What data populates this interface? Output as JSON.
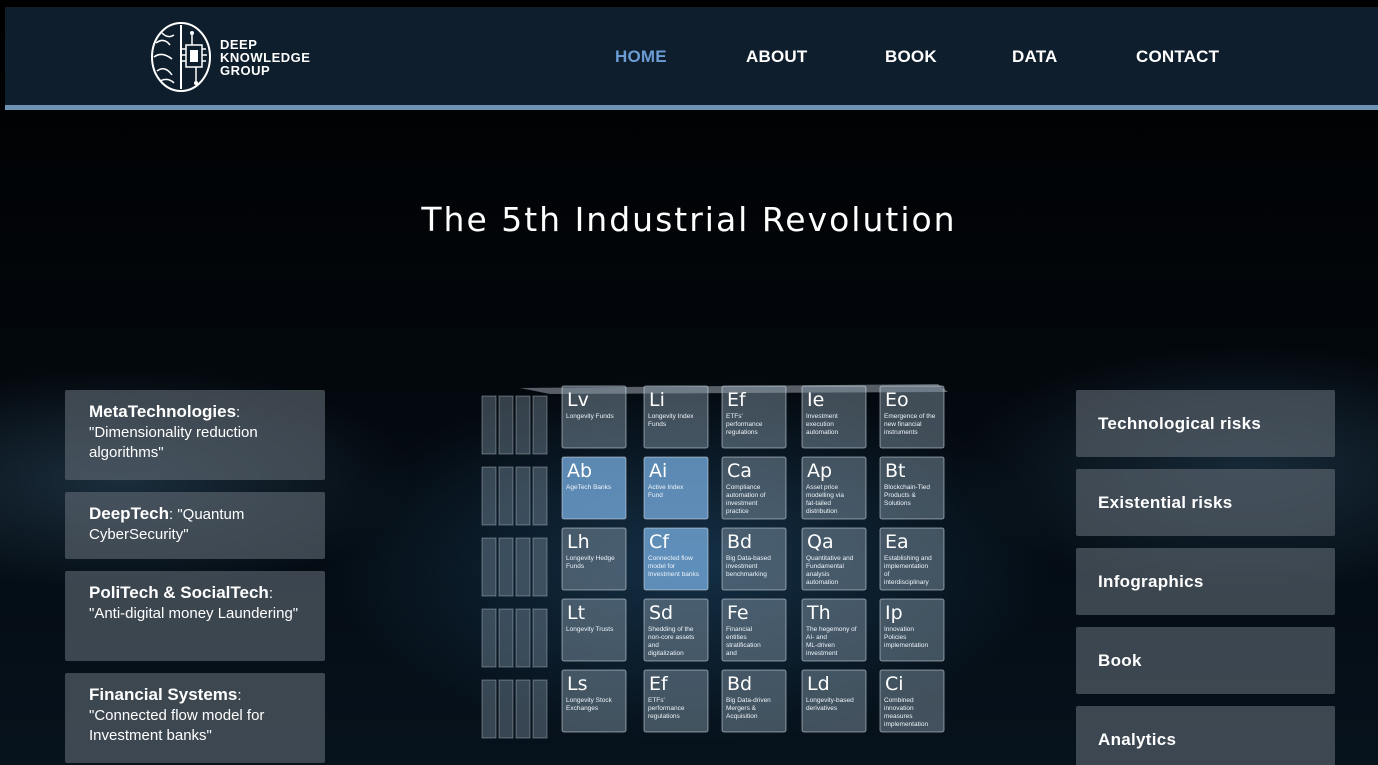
{
  "logo": {
    "line1": "DEEP",
    "line2": "KNOWLEDGE",
    "line3": "GROUP"
  },
  "nav": [
    {
      "label": "HOME",
      "active": true
    },
    {
      "label": "ABOUT"
    },
    {
      "label": "BOOK"
    },
    {
      "label": "DATA"
    },
    {
      "label": "CONTACT"
    }
  ],
  "hero": {
    "title": "The 5th Industrial Revolution"
  },
  "left_cards": [
    {
      "keyword": "MetaTechnologies",
      "text": ": \"Dimensionality reduction algorithms\""
    },
    {
      "keyword": "DeepTech",
      "text": ": \"Quantum CyberSecurity\""
    },
    {
      "keyword": "PoliTech & SocialTech",
      "text": ": \"Anti-digital money Laundering\""
    },
    {
      "keyword": "Financial Systems",
      "text": ": \"Connected flow model for Investment banks\""
    }
  ],
  "right_cards": [
    {
      "label": "Technological risks"
    },
    {
      "label": "Existential risks"
    },
    {
      "label": "Infographics"
    },
    {
      "label": "Book"
    },
    {
      "label": "Analytics"
    }
  ],
  "cube_tiles": [
    {
      "sym": "Lv",
      "label": "Longevity Funds"
    },
    {
      "sym": "Li",
      "label": "Longevity Index Funds"
    },
    {
      "sym": "Ef",
      "label": "ETFs' performance regulations"
    },
    {
      "sym": "Ie",
      "label": "Investment execution automation"
    },
    {
      "sym": "Eo",
      "label": "Emergence of the new financial instruments"
    },
    {
      "sym": "Ab",
      "label": "AgeTech Banks"
    },
    {
      "sym": "Ai",
      "label": "Active Index Fund"
    },
    {
      "sym": "Ca",
      "label": "Compliance automation of investment practice"
    },
    {
      "sym": "Ap",
      "label": "Asset price modelling via fat-tailed distribution"
    },
    {
      "sym": "Bt",
      "label": "Blockchain-Tied Products & Solutions"
    },
    {
      "sym": "Lh",
      "label": "Longevity Hedge Funds"
    },
    {
      "sym": "Cf",
      "label": "Connected flow model for Investment banks"
    },
    {
      "sym": "Bd",
      "label": "Big Data-based investment benchmarking"
    },
    {
      "sym": "Qa",
      "label": "Quantitative and Fundamental analysis automation"
    },
    {
      "sym": "Ea",
      "label": "Establishing and implementation of interdisciplinary education"
    },
    {
      "sym": "Lt",
      "label": "Longevity Trusts"
    },
    {
      "sym": "Sd",
      "label": "Shedding of the non-core assets and digitalization"
    },
    {
      "sym": "Fe",
      "label": "Financial entities stratification and ecosystematic approach"
    },
    {
      "sym": "Th",
      "label": "The hegemony of AI- and ML-driven investment solutions"
    },
    {
      "sym": "Ip",
      "label": "Innovation Policies implementation"
    },
    {
      "sym": "Ls",
      "label": "Longevity Stock Exchanges"
    },
    {
      "sym": "Ef",
      "label": "ETFs' performance regulations"
    },
    {
      "sym": "Bd",
      "label": "Big Data-driven Mergers & Acquisition"
    },
    {
      "sym": "Ld",
      "label": "Longevity-based derivatives"
    },
    {
      "sym": "Ci",
      "label": "Combined innovation measures implementation"
    }
  ]
}
